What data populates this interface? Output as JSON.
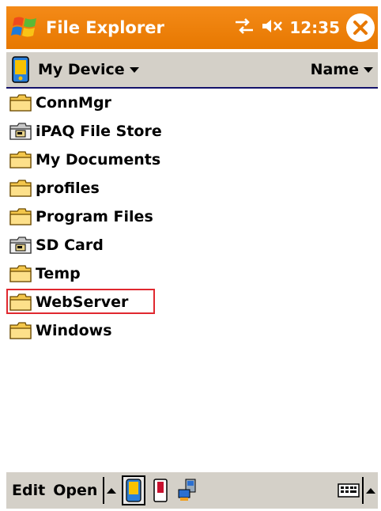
{
  "titlebar": {
    "title": "File Explorer",
    "time": "12:35",
    "icons": [
      "windows-start-icon",
      "connectivity-icon",
      "speaker-muted-icon",
      "close-icon"
    ]
  },
  "header": {
    "location": "My Device",
    "sort_label": "Name"
  },
  "files": [
    {
      "name": "ConnMgr",
      "icon": "folder-icon"
    },
    {
      "name": "iPAQ File Store",
      "icon": "storage-card-folder-icon"
    },
    {
      "name": "My Documents",
      "icon": "folder-icon"
    },
    {
      "name": "profiles",
      "icon": "folder-icon"
    },
    {
      "name": "Program Files",
      "icon": "folder-icon"
    },
    {
      "name": "SD Card",
      "icon": "storage-card-folder-icon"
    },
    {
      "name": "Temp",
      "icon": "folder-icon"
    },
    {
      "name": "WebServer",
      "icon": "folder-icon",
      "highlighted": true
    },
    {
      "name": "Windows",
      "icon": "folder-icon"
    }
  ],
  "cmdbar": {
    "edit_label": "Edit",
    "open_label": "Open",
    "icons": [
      "device-icon",
      "storage-card-icon",
      "network-share-icon",
      "keyboard-icon"
    ]
  },
  "colors": {
    "titlebar": "#e77800",
    "highlight_border": "#e0282f",
    "header_rule": "#14126b",
    "chrome": "#d4d0c8"
  }
}
